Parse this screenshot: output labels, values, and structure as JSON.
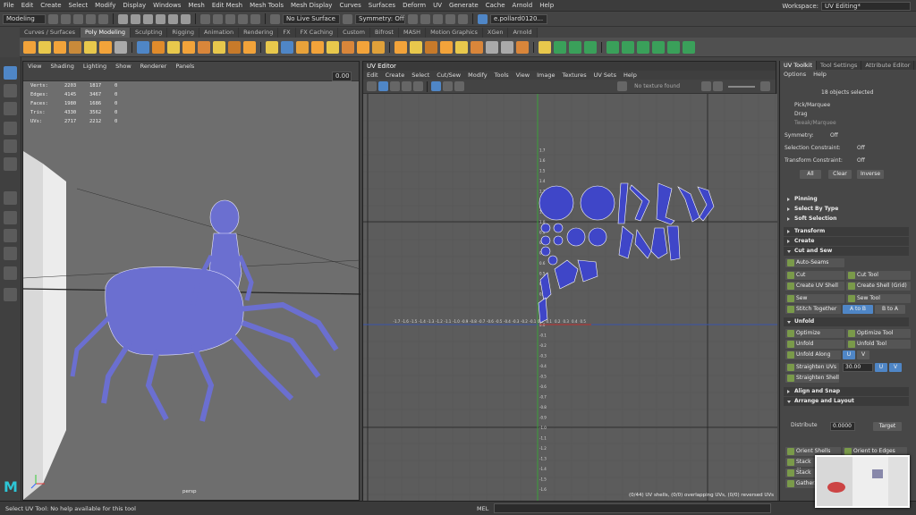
{
  "menubar": {
    "items": [
      "File",
      "Edit",
      "Create",
      "Select",
      "Modify",
      "Display",
      "Windows",
      "Mesh",
      "Edit Mesh",
      "Mesh Tools",
      "Mesh Display",
      "Curves",
      "Surfaces",
      "Deform",
      "UV",
      "Generate",
      "Cache",
      "Arnold",
      "Help"
    ],
    "workspace_label": "Workspace:",
    "workspace_value": "UV Editing*"
  },
  "statusline": {
    "mode": "Modeling",
    "live_surface": "No Live Surface",
    "symmetry": "Symmetry: Off",
    "user": "e.pollard0120..."
  },
  "shelf": {
    "tabs": [
      "Curves / Surfaces",
      "Poly Modeling",
      "Sculpting",
      "Rigging",
      "Animation",
      "Rendering",
      "FX",
      "FX Caching",
      "Custom",
      "Bifrost",
      "MASH",
      "Motion Graphics",
      "XGen",
      "Arnold"
    ],
    "active_tab": 1
  },
  "viewport": {
    "menu": [
      "View",
      "Shading",
      "Lighting",
      "Show",
      "Renderer",
      "Panels"
    ],
    "hud": [
      {
        "label": "Verts:",
        "a": "2203",
        "b": "1817",
        "c": "0"
      },
      {
        "label": "Edges:",
        "a": "4145",
        "b": "3467",
        "c": "0"
      },
      {
        "label": "Faces:",
        "a": "1980",
        "b": "1686",
        "c": "0"
      },
      {
        "label": "Tris:",
        "a": "4330",
        "b": "3562",
        "c": "0"
      },
      {
        "label": "UVs:",
        "a": "2717",
        "b": "2212",
        "c": "0"
      }
    ],
    "field_value": "0.00",
    "camera_label": "persp",
    "logo": "M"
  },
  "uv_editor": {
    "title": "UV Editor",
    "menu": [
      "Edit",
      "Create",
      "Select",
      "Cut/Sew",
      "Modify",
      "Tools",
      "View",
      "Image",
      "Textures",
      "UV Sets",
      "Help"
    ],
    "no_texture": "No texture found",
    "status": "(0/44) UV shells, (0/0) overlapping UVs, (0/0) reversed UVs",
    "x_ticks": [
      "-1.7",
      "-1.6",
      "-1.5",
      "-1.4",
      "-1.3",
      "-1.2",
      "-1.1",
      "-1.0",
      "-0.9",
      "-0.8",
      "-0.7",
      "-0.6",
      "-0.5",
      "-0.4",
      "-0.3",
      "-0.2",
      "-0.1",
      "0.0",
      "0.1",
      "0.2",
      "0.3",
      "0.4",
      "0.5"
    ],
    "y_ticks": [
      "1.7",
      "1.6",
      "1.5",
      "1.4",
      "1.3",
      "1.2",
      "1.1",
      "1.0",
      "0.9",
      "0.8",
      "0.7",
      "0.6",
      "0.5",
      "0.4",
      "0.3",
      "0.2",
      "0.1",
      "0.0",
      "-0.1",
      "-0.2",
      "-0.3",
      "-0.4",
      "-0.5",
      "-0.6",
      "-0.7",
      "-0.8",
      "-0.9",
      "-1.0",
      "-1.1",
      "-1.2",
      "-1.3",
      "-1.4",
      "-1.5",
      "-1.6"
    ]
  },
  "right_panel": {
    "tabs": [
      "UV Toolkit",
      "Tool Settings",
      "Attribute Editor"
    ],
    "options": [
      "Options",
      "Help"
    ],
    "selected_count": "18 objects selected",
    "pick_modes": [
      "Pick/Marquee",
      "Drag",
      "Tweak/Marquee"
    ],
    "symmetry_label": "Symmetry:",
    "symmetry_value": "Off",
    "selection_constraint_label": "Selection Constraint:",
    "selection_constraint_value": "Off",
    "transform_constraint_label": "Transform Constraint:",
    "transform_constraint_value": "Off",
    "select_buttons": [
      "All",
      "Clear",
      "Inverse"
    ],
    "sub_sections": [
      "Pinning",
      "Select By Type",
      "Soft Selection"
    ],
    "sections": {
      "transform": "Transform",
      "create": "Create",
      "cut_and_sew": "Cut and Sew",
      "unfold": "Unfold",
      "align_snap": "Align and Snap",
      "arrange": "Arrange and Layout"
    },
    "cut_tools": {
      "auto_seams": "Auto-Seams",
      "cut": "Cut",
      "cut_tool": "Cut Tool",
      "create_shell": "Create UV Shell",
      "create_shell_grid": "Create Shell (Grid)",
      "sew": "Sew",
      "sew_tool": "Sew Tool",
      "stitch": "Stitch Together",
      "a_to_b": "A to B",
      "b_to_a": "B to A"
    },
    "unfold_tools": {
      "optimize": "Optimize",
      "optimize_tool": "Optimize Tool",
      "unfold": "Unfold",
      "unfold_tool": "Unfold Tool",
      "unfold_along": "Unfold Along",
      "u": "U",
      "v": "V",
      "straighten_uvs": "Straighten UVs",
      "straighten_value": "30.00",
      "straighten_shell": "Straighten Shell"
    },
    "arrange_tools": {
      "distribute": "Distribute",
      "distribute_value": "0.0000",
      "target": "Target",
      "orient_shells": "Orient Shells",
      "orient_edges": "Orient to Edges",
      "stack_shells": "Stack Sh...",
      "stack_and": "Stack a...",
      "gather": "Gather..."
    }
  },
  "command_line": {
    "help": "Select UV Tool: No help available for this tool",
    "mel": "MEL"
  }
}
